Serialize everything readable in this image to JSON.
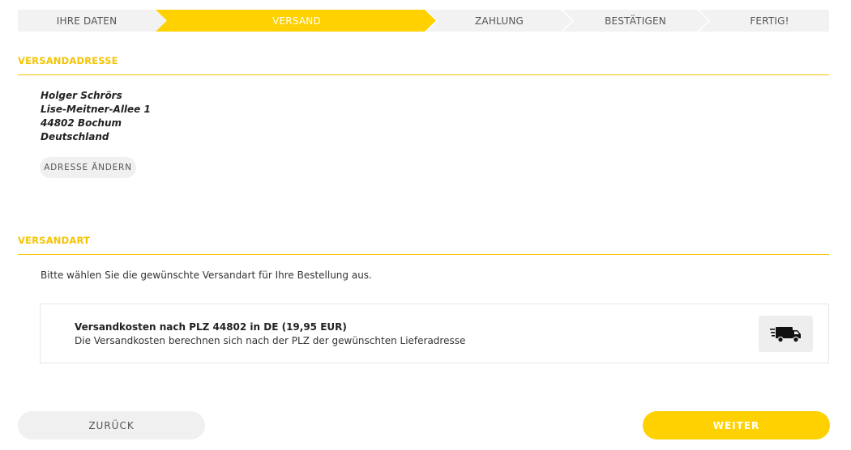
{
  "stepper": {
    "steps": [
      {
        "label": "IHRE DATEN",
        "active": false
      },
      {
        "label": "VERSAND",
        "active": true
      },
      {
        "label": "ZAHLUNG",
        "active": false
      },
      {
        "label": "BESTÄTIGEN",
        "active": false
      },
      {
        "label": "FERTIG!",
        "active": false
      }
    ]
  },
  "shipping_address": {
    "title": "VERSANDADRESSE",
    "name": "Holger Schrörs",
    "street": "Lise-Meitner-Allee 1",
    "city": "44802 Bochum",
    "country": "Deutschland",
    "change_label": "ADRESSE ÄNDERN"
  },
  "shipping_method": {
    "title": "VERSANDART",
    "intro": "Bitte wählen Sie die gewünschte Versandart für Ihre Bestellung aus.",
    "option_title": "Versandkosten nach PLZ 44802 in DE (19,95 EUR)",
    "option_desc": "Die Versandkosten berechnen sich nach der PLZ der gewünschten Lieferadresse",
    "icon": "truck-icon"
  },
  "navigation": {
    "back_label": "ZURÜCK",
    "next_label": "WEITER"
  },
  "colors": {
    "accent": "#ffd100",
    "accent_text": "#f5c400",
    "inactive_step": "#f2f2f2"
  }
}
